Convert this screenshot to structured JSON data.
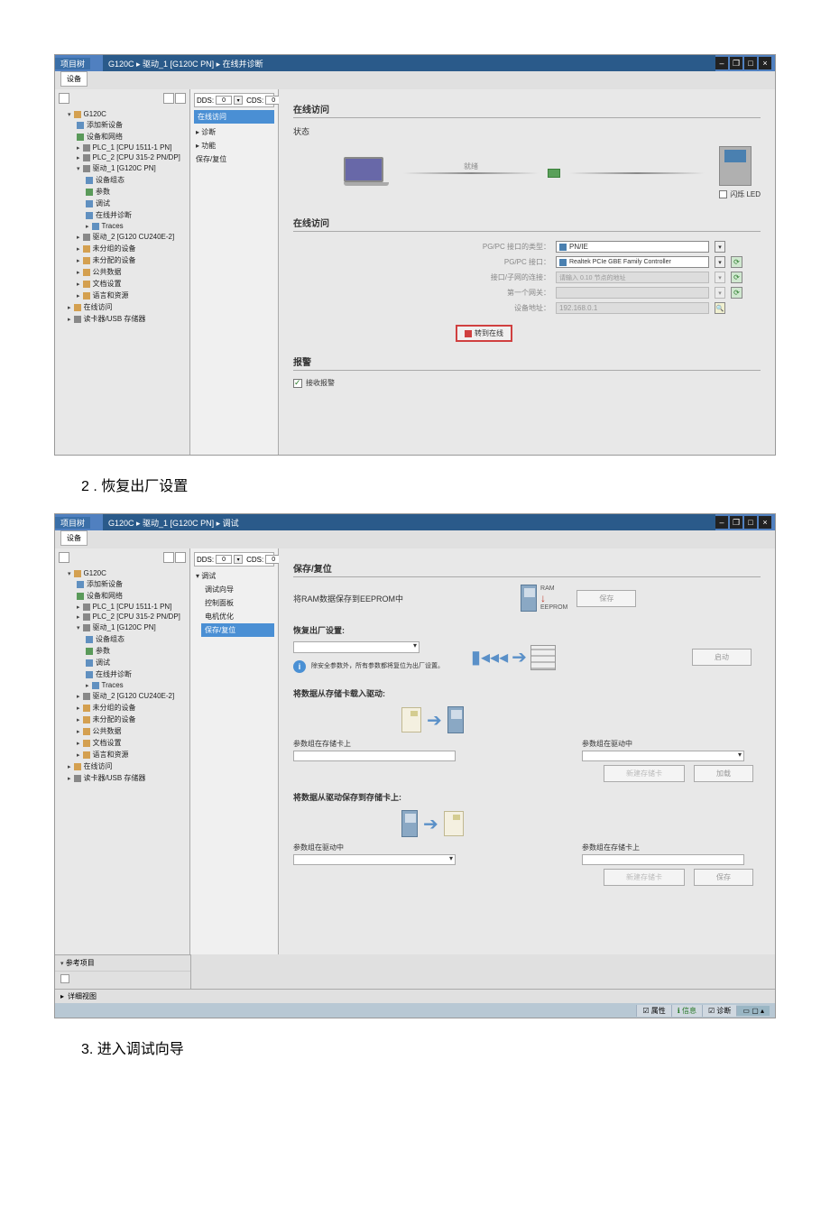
{
  "caption1": "2 . 恢复出厂设置",
  "caption2": "3. 进入调试向导",
  "s1": {
    "titlebar_left": "项目树",
    "breadcrumb": "G120C ▸ 驱动_1 [G120C PN] ▸ 在线并诊断",
    "tab": "设备",
    "dds_label": "DDS:",
    "dds_val": "0",
    "cds_label": "CDS:",
    "cds_val": "0",
    "mid_btn": "在线访问",
    "mid_items": [
      "诊断",
      "功能",
      "保存/复位"
    ],
    "tree": {
      "root": "G120C",
      "i1": "添加新设备",
      "i2": "设备和网络",
      "i3": "PLC_1 [CPU 1511-1 PN]",
      "i4": "PLC_2 [CPU 315-2 PN/DP]",
      "drive": "驱动_1 [G120C PN]",
      "d1": "设备组态",
      "d2": "参数",
      "d3": "调试",
      "d4": "在线并诊断",
      "d5": "Traces",
      "drive2": "驱动_2 [G120 CU240E-2]",
      "i5": "未分组的设备",
      "i6": "未分配的设备",
      "i7": "公共数据",
      "i8": "文档设置",
      "i9": "语言和资源",
      "i10": "在线访问",
      "i11": "读卡器/USB 存储器"
    },
    "c": {
      "online_title": "在线访问",
      "status_title": "状态",
      "conn_label": "就绪",
      "led_label": "闪烁 LED",
      "pgpc_type": "PG/PC 接口的类型：",
      "pgpc_type_val": "PN/IE",
      "pgpc_iface": "PG/PC 接口：",
      "pgpc_iface_val": "Realtek PCIe GBE Family Controller",
      "iface_sub": "接口/子网的连接：",
      "iface_sub_val": "请输入 0.10 节点的地址",
      "gateway": "第一个网关：",
      "gateway_val": "",
      "addr": "设备地址：",
      "addr_val": "192.168.0.1",
      "convert_btn": "转到在线",
      "alarm_title": "报警",
      "alarm_chk": "接收报警"
    }
  },
  "s2": {
    "breadcrumb": "G120C ▸ 驱动_1 [G120C PN] ▸ 调试",
    "mid_hdr": "调试",
    "mid_items": [
      "调试向导",
      "控制面板",
      "电机优化",
      "保存/复位"
    ],
    "c": {
      "save_title": "保存/复位",
      "save_label": "将RAM数据保存到EEPROM中",
      "ram": "RAM",
      "eeprom": "EEPROM",
      "btn_save": "保存",
      "reset_title": "恢复出厂设置:",
      "info_text": "除安全参数外，所有参数都将复位为出厂设置。",
      "btn_reset": "启动",
      "load_drive_title": "将数据从存储卡载入驱动:",
      "src_card": "参数组在存储卡上",
      "src_drive": "参数组在驱动中",
      "btn_load": "加载",
      "btn_create": "新建存储卡",
      "save_card_title": "将数据从驱动保存到存储卡上:",
      "btn_save2": "保存",
      "btn_create2": "新建存储卡"
    },
    "ref_panel": "参考项目",
    "detail_panel": "详细视图",
    "footer_tabs": [
      "属性",
      "信息",
      "诊断"
    ]
  }
}
